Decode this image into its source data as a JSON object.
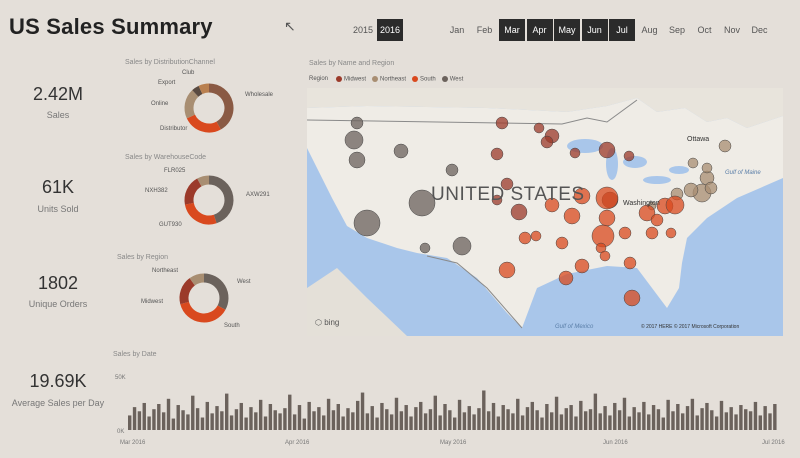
{
  "title": "US Sales Summary",
  "years": [
    {
      "label": "2015",
      "selected": false
    },
    {
      "label": "2016",
      "selected": true
    }
  ],
  "months": [
    {
      "label": "Jan",
      "selected": false
    },
    {
      "label": "Feb",
      "selected": false
    },
    {
      "label": "Mar",
      "selected": true
    },
    {
      "label": "Apr",
      "selected": true
    },
    {
      "label": "May",
      "selected": true
    },
    {
      "label": "Jun",
      "selected": true
    },
    {
      "label": "Jul",
      "selected": true
    },
    {
      "label": "Aug",
      "selected": false
    },
    {
      "label": "Sep",
      "selected": false
    },
    {
      "label": "Oct",
      "selected": false
    },
    {
      "label": "Nov",
      "selected": false
    },
    {
      "label": "Dec",
      "selected": false
    }
  ],
  "kpis": {
    "sales": {
      "value": "2.42M",
      "label": "Sales"
    },
    "units": {
      "value": "61K",
      "label": "Units Sold"
    },
    "orders": {
      "value": "1802",
      "label": "Unique Orders"
    },
    "avg": {
      "value": "19.69K",
      "label": "Average Sales per Day"
    }
  },
  "donuts": {
    "channel": {
      "title": "Sales by DistributionChannel",
      "labels": [
        "Club",
        "Export",
        "Online",
        "Distributor",
        "Wholesale"
      ],
      "slices": [
        {
          "name": "Wholesale",
          "value": 42,
          "color": "#8a5a44"
        },
        {
          "name": "Distributor",
          "value": 26,
          "color": "#d9491e"
        },
        {
          "name": "Online",
          "value": 20,
          "color": "#a88e72"
        },
        {
          "name": "Export",
          "value": 5,
          "color": "#5a4a40"
        },
        {
          "name": "Club",
          "value": 7,
          "color": "#b98050"
        }
      ]
    },
    "warehouse": {
      "title": "Sales by WarehouseCode",
      "labels": [
        "FLR025",
        "NXH382",
        "AXW291",
        "GUT930"
      ],
      "slices": [
        {
          "name": "AXW291",
          "value": 45,
          "color": "#6b625c"
        },
        {
          "name": "GUT930",
          "value": 27,
          "color": "#d9491e"
        },
        {
          "name": "NXH382",
          "value": 20,
          "color": "#9b3a2a"
        },
        {
          "name": "FLR025",
          "value": 8,
          "color": "#a88e72"
        }
      ]
    },
    "region": {
      "title": "Sales by Region",
      "labels": [
        "Northeast",
        "West",
        "Midwest",
        "South"
      ],
      "slices": [
        {
          "name": "West",
          "value": 33,
          "color": "#6b625c"
        },
        {
          "name": "South",
          "value": 38,
          "color": "#d9491e"
        },
        {
          "name": "Midwest",
          "value": 19,
          "color": "#9b3a2a"
        },
        {
          "name": "Northeast",
          "value": 10,
          "color": "#a88e72"
        }
      ]
    }
  },
  "map": {
    "title": "Sales by Name and Region",
    "legend_title": "Region",
    "legend": [
      {
        "name": "Midwest",
        "color": "#9b3a2a"
      },
      {
        "name": "Northeast",
        "color": "#a88e72"
      },
      {
        "name": "South",
        "color": "#d9491e"
      },
      {
        "name": "West",
        "color": "#6b625c"
      }
    ],
    "country_label": "UNITED STATES",
    "ottawa": "Ottawa",
    "washington": "Washington",
    "gulf_mexico": "Gulf of Mexico",
    "gulf_maine": "Gulf of Maine",
    "bing": "bing",
    "copyright": "© 2017 HERE  © 2017 Microsoft Corporation"
  },
  "chart_data": {
    "type": "bar",
    "title": "Sales by Date",
    "ylabel": "",
    "ylim": [
      0,
      50000
    ],
    "y_ticks": [
      "50K",
      "0K"
    ],
    "x_ticks": [
      "Mar 2016",
      "Apr 2016",
      "May 2016",
      "Jun 2016",
      "Jul 2016"
    ],
    "values": [
      14,
      22,
      18,
      26,
      13,
      20,
      25,
      17,
      30,
      11,
      24,
      19,
      15,
      33,
      21,
      12,
      27,
      16,
      23,
      18,
      35,
      14,
      20,
      26,
      12,
      22,
      17,
      29,
      13,
      25,
      19,
      16,
      21,
      34,
      15,
      24,
      11,
      27,
      18,
      22,
      14,
      30,
      19,
      25,
      13,
      21,
      17,
      28,
      36,
      16,
      23,
      12,
      26,
      20,
      15,
      31,
      18,
      24,
      13,
      22,
      27,
      16,
      20,
      33,
      14,
      25,
      19,
      12,
      29,
      17,
      23,
      15,
      21,
      38,
      18,
      26,
      13,
      24,
      20,
      16,
      30,
      14,
      22,
      27,
      19,
      12,
      25,
      17,
      32,
      15,
      21,
      24,
      13,
      28,
      18,
      20,
      35,
      16,
      23,
      14,
      26,
      19,
      31,
      13,
      22,
      17,
      27,
      15,
      24,
      20,
      12,
      29,
      18,
      25,
      16,
      23,
      30,
      14,
      21,
      26,
      19,
      13,
      28,
      17,
      22,
      15,
      24,
      20,
      18,
      27,
      14,
      23,
      16,
      25
    ]
  }
}
